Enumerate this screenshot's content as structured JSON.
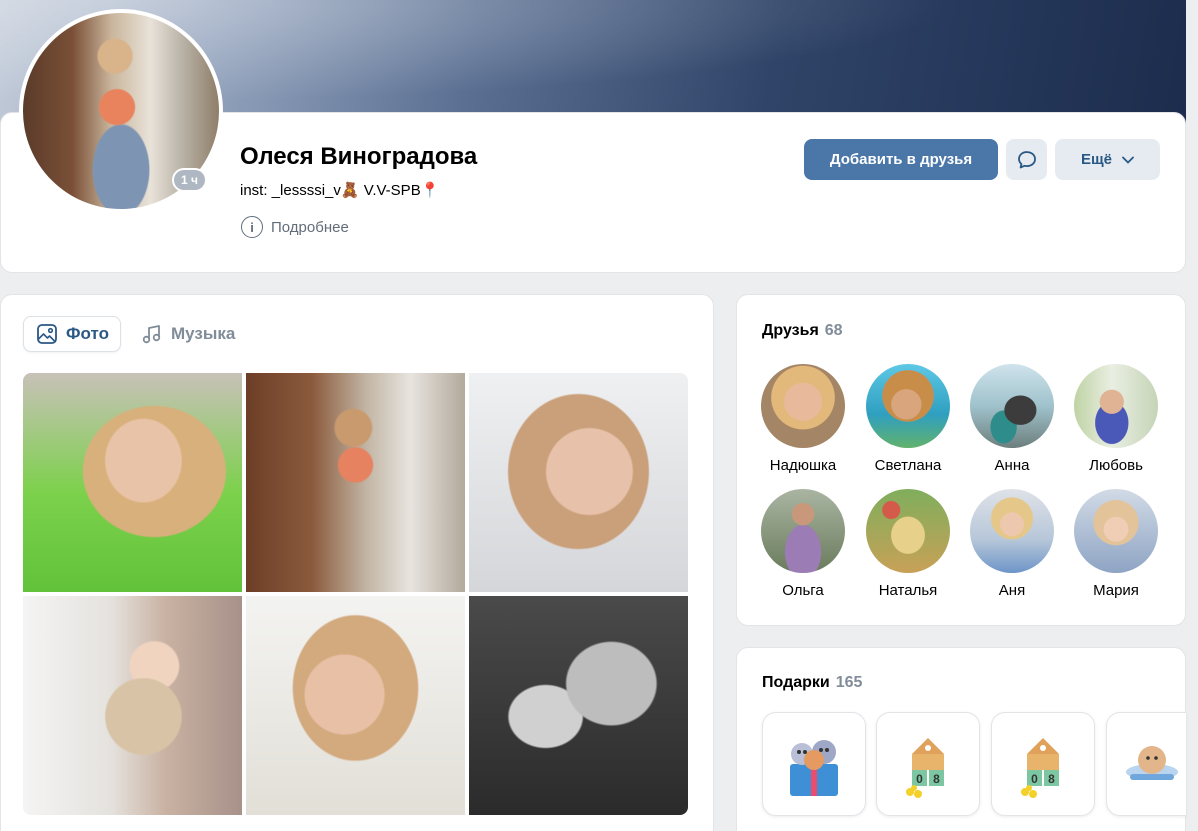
{
  "profile": {
    "name": "Олеся Виноградова",
    "status": "inst: _lessssi_v🧸 V.V-SPB📍",
    "details_label": "Подробнее",
    "online": "1 ч"
  },
  "actions": {
    "add_friend": "Добавить в друзья",
    "more": "Ещё"
  },
  "tabs": [
    {
      "label": "Фото",
      "active": true
    },
    {
      "label": "Музыка",
      "active": false
    }
  ],
  "friends": {
    "title": "Друзья",
    "count": "68",
    "items": [
      {
        "name": "Надюшка",
        "color": "#d9a87f"
      },
      {
        "name": "Светлана",
        "color": "#3fa7c9"
      },
      {
        "name": "Анна",
        "color": "#4f8f8a"
      },
      {
        "name": "Любовь",
        "color": "#6f7fc4"
      },
      {
        "name": "Ольга",
        "color": "#7d8a6a"
      },
      {
        "name": "Наталья",
        "color": "#c79a4a"
      },
      {
        "name": "Аня",
        "color": "#b8b8c8"
      },
      {
        "name": "Мария",
        "color": "#8fa1c7"
      }
    ]
  },
  "gifts": {
    "title": "Подарки",
    "count": "165",
    "items": [
      {
        "name": "gift-cats-box",
        "label": ""
      },
      {
        "name": "gift-calendar-08",
        "label": "08"
      },
      {
        "name": "gift-calendar-08",
        "label": "08"
      },
      {
        "name": "gift-cat-card",
        "label": ""
      }
    ]
  },
  "colors": {
    "accent": "#4a76a8",
    "link": "#2a5885",
    "muted": "#818c99",
    "background": "#edeef0"
  }
}
